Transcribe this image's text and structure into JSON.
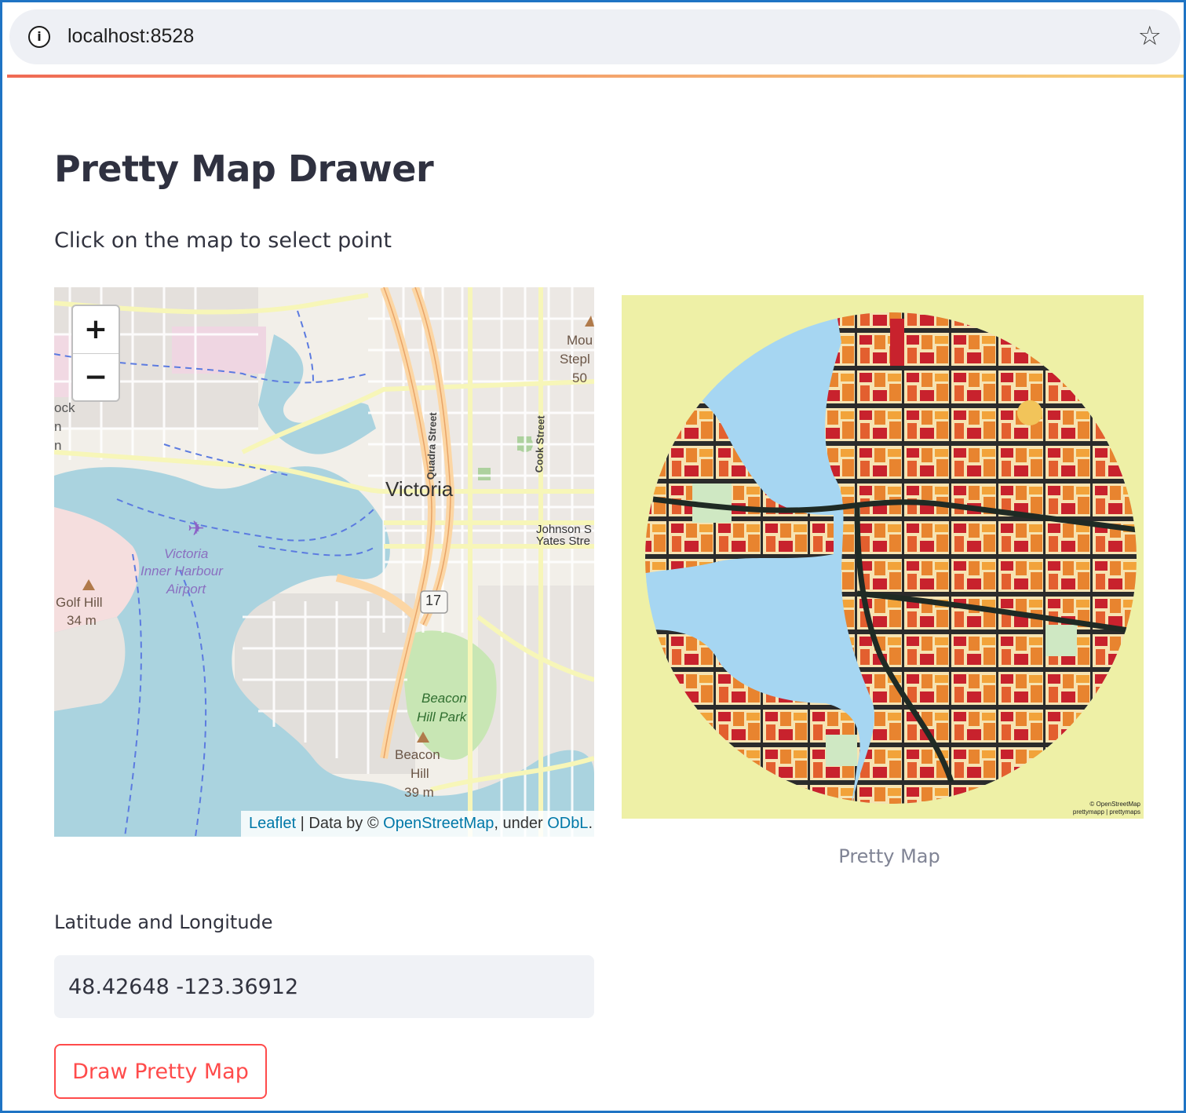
{
  "browser": {
    "url": "localhost:8528",
    "info_icon": "info-icon",
    "bookmark_icon": "star-icon"
  },
  "page": {
    "title": "Pretty Map Drawer",
    "instruction": "Click on the map to select point"
  },
  "osm_map": {
    "zoom_in": "+",
    "zoom_out": "−",
    "labels": {
      "city": "Victoria",
      "quadra": "Quadra Street",
      "cook": "Cook Street",
      "johnson": "Johnson S",
      "yates": "Yates Stre",
      "airport1": "Victoria",
      "airport2": "Inner Harbour",
      "airport3": "Airport",
      "golf1": "Golf Hill",
      "golf2": "34 m",
      "beaconpark1": "Beacon",
      "beaconpark2": "Hill Park",
      "beaconhill1": "Beacon",
      "beaconhill2": "Hill",
      "beaconhill3": "39 m",
      "mount1": "Mou",
      "mount2": "Stepl",
      "mount3": "50",
      "hwy": "17",
      "rock1": "ock",
      "rock2": "n",
      "rock3": "n"
    },
    "attribution": {
      "leaflet": "Leaflet",
      "mid": " | Data by © ",
      "osm": "OpenStreetMap",
      "under": ", under ",
      "odbl": "ODbL",
      "end": "."
    }
  },
  "pretty_map": {
    "caption": "Pretty Map",
    "credit1": "© OpenStreetMap",
    "credit2": "prettymapp | prettymaps"
  },
  "form": {
    "label": "Latitude and Longitude",
    "value": "48.42648 -123.36912",
    "button": "Draw Pretty Map"
  },
  "colors": {
    "accent": "#ff4b4b",
    "frame": "#1f74c4",
    "water": "#a8d4ee",
    "background_map": "#eef0a6"
  }
}
